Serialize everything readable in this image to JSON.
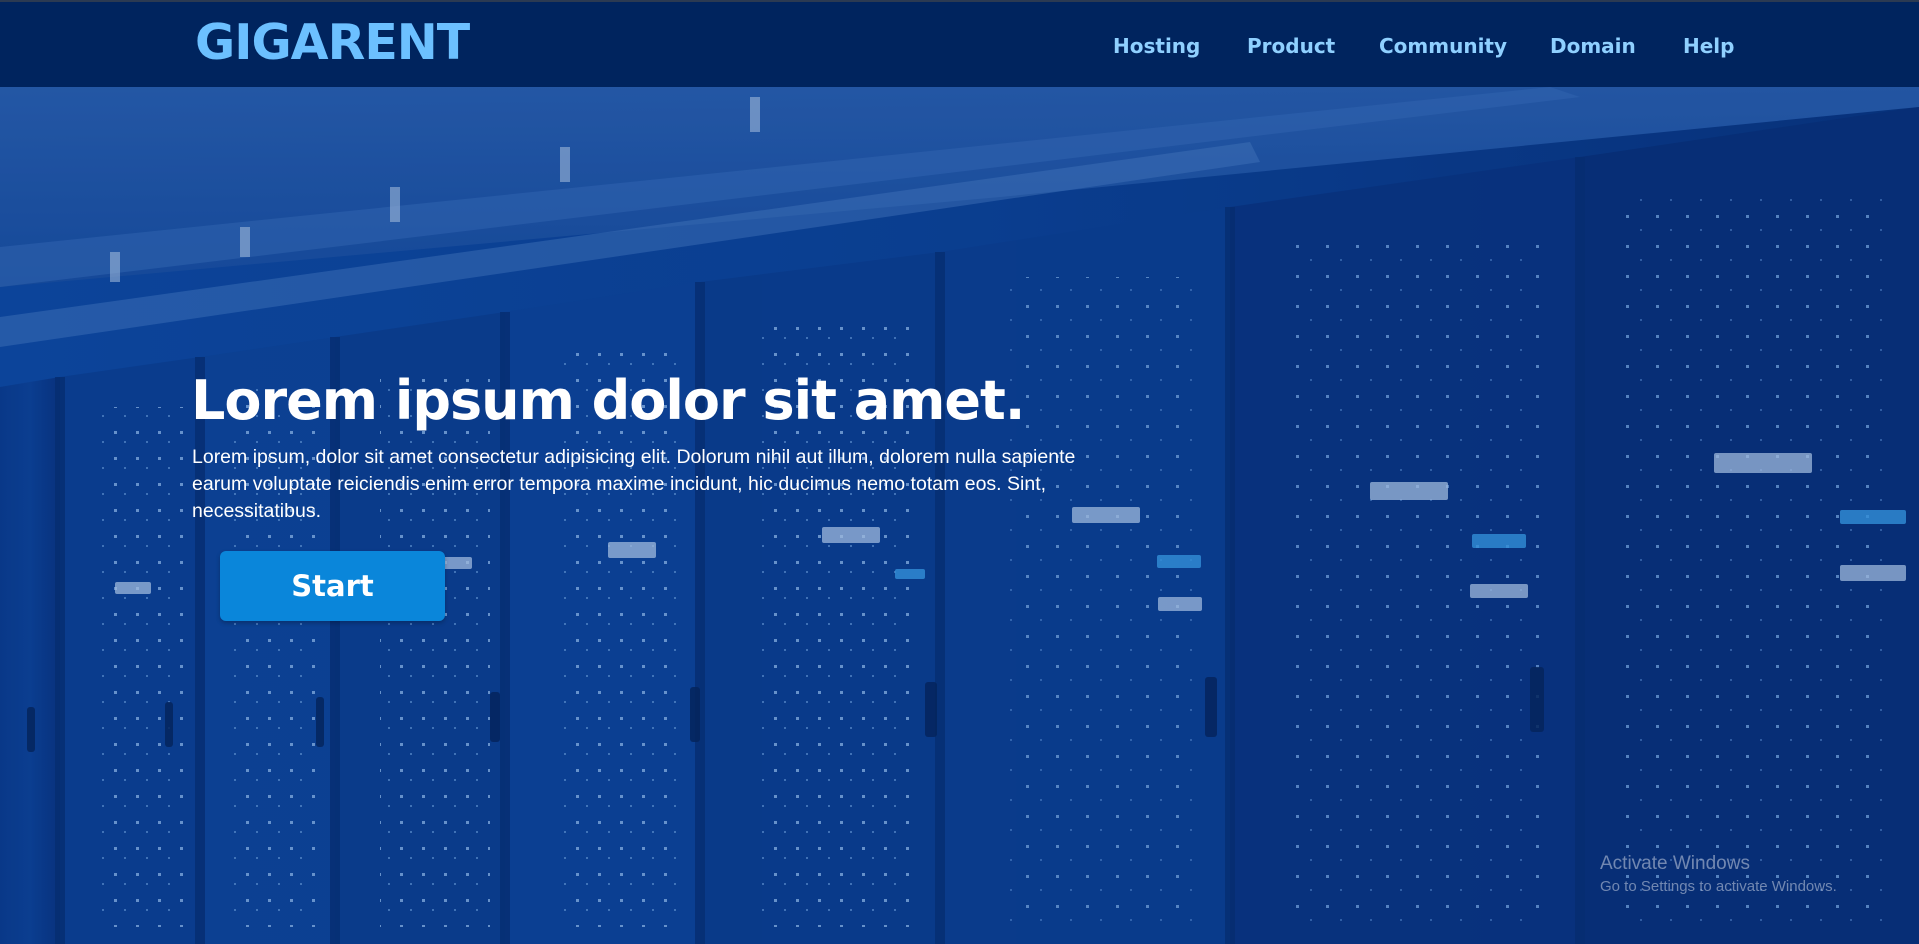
{
  "brand": {
    "logo_text": "GIGARENT",
    "color": "#6cc0ff"
  },
  "nav": {
    "items": [
      {
        "label": "Hosting"
      },
      {
        "label": "Product"
      },
      {
        "label": "Community"
      },
      {
        "label": "Domain"
      },
      {
        "label": "Help"
      }
    ]
  },
  "hero": {
    "title": "Lorem ipsum dolor sit amet.",
    "body": "Lorem ipsum, dolor sit amet consectetur adipisicing elit. Dolorum nihil aut illum, dolorem nulla sapiente earum voluptate reiciendis enim error tempora maxime incidunt, hic ducimus nemo totam eos. Sint, necessitatibus.",
    "cta_label": "Start",
    "cta_color": "#0a86da",
    "background": "server-room-image"
  },
  "os_watermark": {
    "title": "Activate Windows",
    "subtitle": "Go to Settings to activate Windows."
  },
  "colors": {
    "navbar_bg": "#00245e",
    "nav_link": "#8fd0ff",
    "hero_overlay": "#0a3a82"
  }
}
